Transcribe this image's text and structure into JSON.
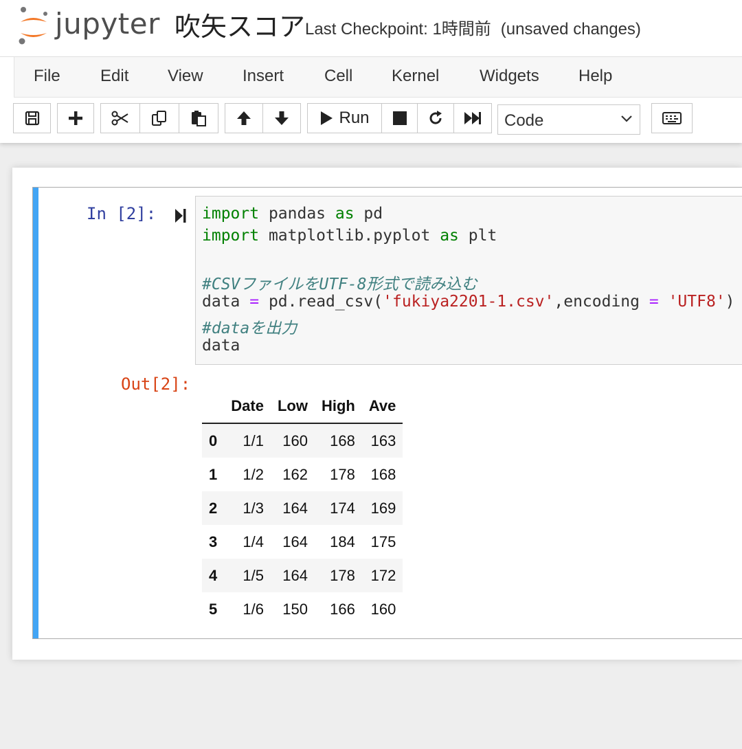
{
  "header": {
    "logo_text": "jupyter",
    "notebook_name": "吹矢スコア",
    "checkpoint": "Last Checkpoint: 1時間前",
    "unsaved": "(unsaved changes)",
    "brand_color": "#f37726"
  },
  "menu": {
    "items": [
      "File",
      "Edit",
      "View",
      "Insert",
      "Cell",
      "Kernel",
      "Widgets",
      "Help"
    ]
  },
  "toolbar": {
    "run_label": "Run",
    "cell_type": "Code",
    "icons": [
      "save-icon",
      "plus-icon",
      "scissors-icon",
      "copy-icon",
      "paste-icon",
      "arrow-up-icon",
      "arrow-down-icon",
      "play-icon",
      "stop-icon",
      "restart-icon",
      "fast-forward-icon",
      "keyboard-icon"
    ]
  },
  "cell": {
    "in_prompt": "In [2]:",
    "out_prompt": "Out[2]:",
    "selected_color": "#42a5f5",
    "code": {
      "l1_kw": "import",
      "l1_mod": " pandas ",
      "l1_as": "as",
      "l1_alias": " pd",
      "l2_kw": "import",
      "l2_mod": " matplotlib.pyplot ",
      "l2_as": "as",
      "l2_alias": " plt",
      "l3_comment": "#CSVファイルをUTF-8形式で読み込む",
      "l4_a": "data ",
      "l4_eq": "=",
      "l4_b": " pd.read_csv(",
      "l4_str1": "'fukiya2201-1.csv'",
      "l4_c": ",encoding ",
      "l4_eq2": "=",
      "l4_d": " ",
      "l4_str2": "'UTF8'",
      "l4_e": ")",
      "l5_comment": "#dataを出力",
      "l6": "data"
    }
  },
  "table": {
    "columns": [
      "",
      "Date",
      "Low",
      "High",
      "Ave"
    ],
    "rows": [
      [
        "0",
        "1/1",
        "160",
        "168",
        "163"
      ],
      [
        "1",
        "1/2",
        "162",
        "178",
        "168"
      ],
      [
        "2",
        "1/3",
        "164",
        "174",
        "169"
      ],
      [
        "3",
        "1/4",
        "164",
        "184",
        "175"
      ],
      [
        "4",
        "1/5",
        "164",
        "178",
        "172"
      ],
      [
        "5",
        "1/6",
        "150",
        "166",
        "160"
      ]
    ]
  }
}
